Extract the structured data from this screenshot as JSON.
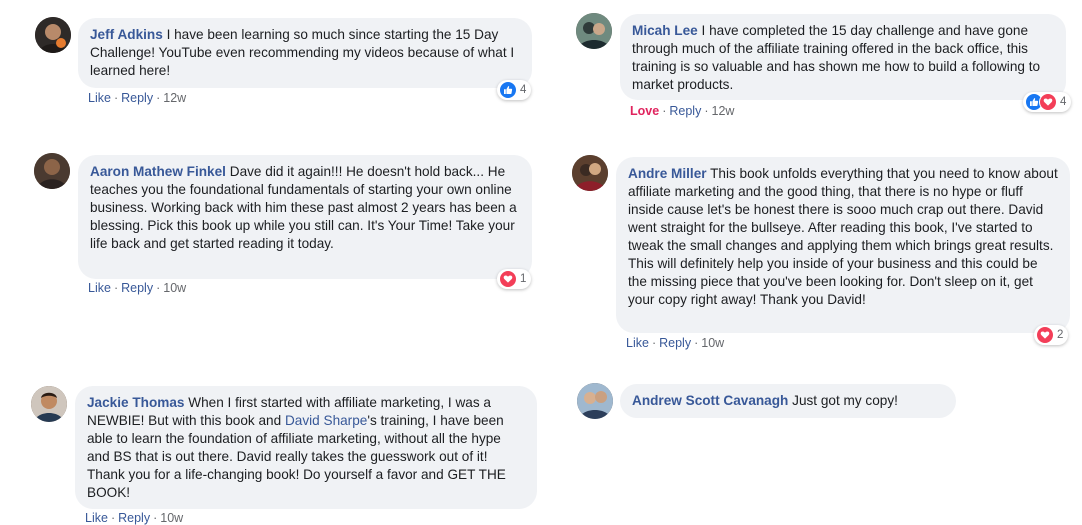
{
  "comments": [
    {
      "name": "Jeff Adkins",
      "text": "I have been learning so much since starting the 15 Day Challenge! YouTube even recommending my videos because of what I learned here!",
      "like": "Like",
      "reply": "Reply",
      "time": "12w",
      "reaction_count": "4",
      "reactions": [
        "like-icon"
      ]
    },
    {
      "name": "Micah Lee",
      "text": "I have completed the 15 day challenge and have gone through much of the affiliate training offered in the back office, this training is so valuable and has shown me how to build a following to market products.",
      "like": "Love",
      "reply": "Reply",
      "time": "12w",
      "reaction_count": "4",
      "reactions": [
        "like-icon",
        "heart-icon"
      ]
    },
    {
      "name": "Aaron Mathew Finkel",
      "text": "Dave did it again!!! He doesn't hold back... He teaches you the foundational fundamentals of starting your own online business. Working back with him these past almost 2 years has been a blessing. Pick this book up while you still can. It's Your Time! Take your life back and get started reading it today.",
      "like": "Like",
      "reply": "Reply",
      "time": "10w",
      "reaction_count": "1",
      "reactions": [
        "heart-icon"
      ]
    },
    {
      "name": "Andre Miller",
      "text": "This book unfolds everything that you need to know about affiliate marketing and the good thing, that there is no hype or fluff inside cause let's be honest there is sooo much crap out there. David went straight for the bullseye. After reading this book, I've started to tweak the small changes and applying them which brings great results. This will definitely help you inside of your business and this could be the missing piece that you've been looking for. Don't sleep on it, get your copy right away! Thank you David!",
      "like": "Like",
      "reply": "Reply",
      "time": "10w",
      "reaction_count": "2",
      "reactions": [
        "heart-icon"
      ]
    },
    {
      "name": "Jackie Thomas",
      "text_before": "When I first started with affiliate marketing, I was a NEWBIE! But with this book and",
      "text_link": "David Sharpe",
      "text_after": "'s training, I have been able to learn the foundation of affiliate marketing, without all the hype and BS that is out there. David really takes the guesswork out of it! Thank you for a life-changing book! Do yourself a favor and GET THE BOOK!",
      "like": "Like",
      "reply": "Reply",
      "time": "10w"
    },
    {
      "name": "Andrew Scott Cavanagh",
      "text": "Just got my copy!"
    }
  ],
  "colors": {
    "name_link": "#385898",
    "bubble_bg": "#f0f2f5",
    "love": "#e0245e",
    "like_icon_bg": "#1877f2",
    "heart_icon_bg": "#f33e58",
    "meta_text": "#65676b"
  }
}
